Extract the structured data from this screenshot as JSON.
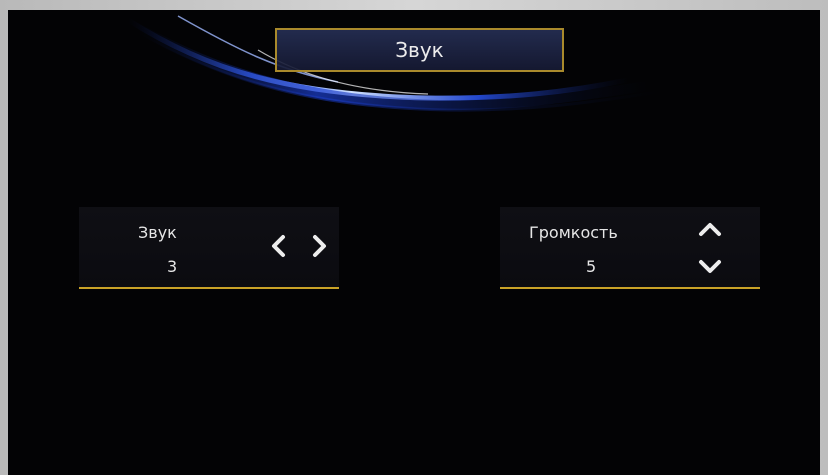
{
  "header": {
    "title": "Звук"
  },
  "controls": {
    "sound": {
      "label": "Звук",
      "value": "3",
      "prev_icon": "chevron-left-icon",
      "next_icon": "chevron-right-icon"
    },
    "volume": {
      "label": "Громкость",
      "value": "5",
      "up_icon": "chevron-up-icon",
      "down_icon": "chevron-down-icon"
    }
  },
  "colors": {
    "background": "#030305",
    "accent_border": "#c9a227",
    "title_border": "#a98a2c",
    "text": "#e6e6e6",
    "swoosh_blue": "#2b59ff"
  }
}
